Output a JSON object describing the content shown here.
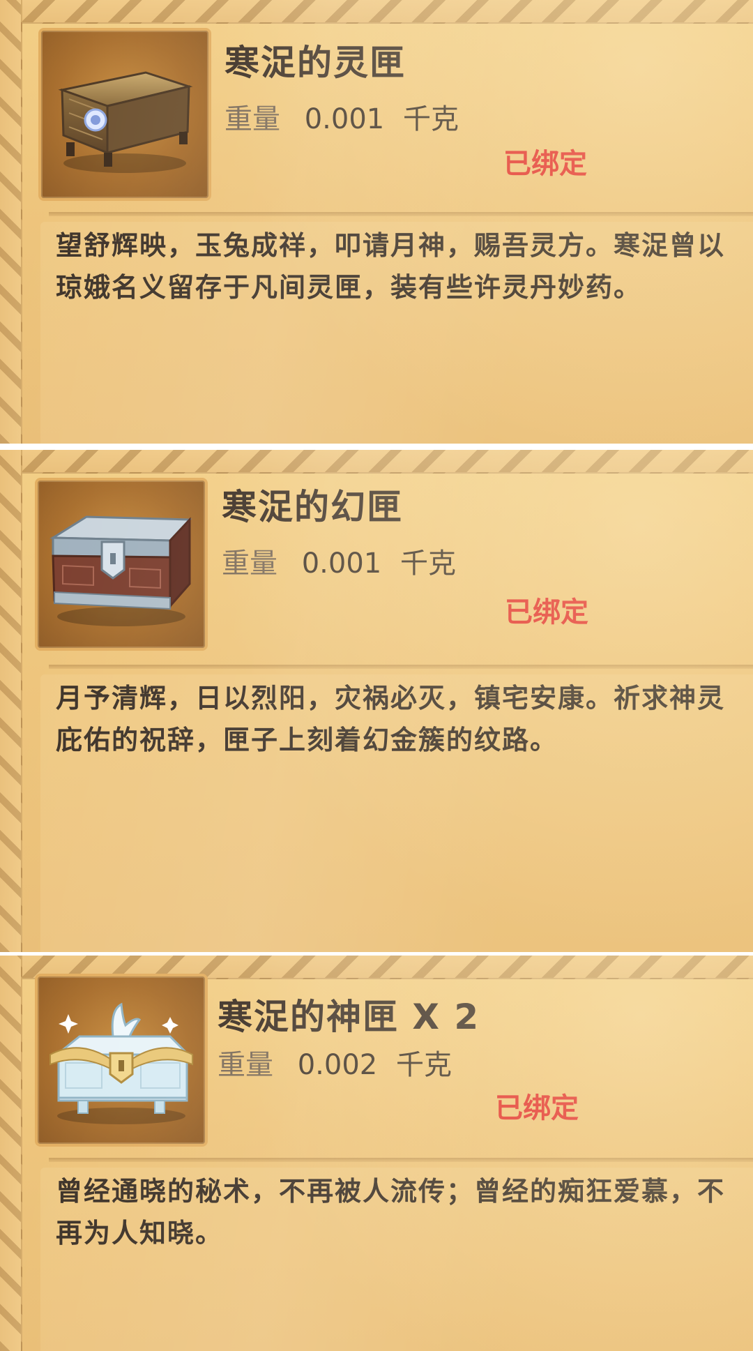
{
  "items": [
    {
      "name": "寒浞的灵匣",
      "weight_label": "重量",
      "weight_value": "0.001",
      "weight_unit": "千克",
      "status": "已绑定",
      "description": "望舒辉映，玉兔成祥，叩请月神，赐吾灵方。寒浞曾以琼娥名义留存于凡间灵匣，装有些许灵丹妙药。",
      "icon": "ornate-bronze-chest-icon"
    },
    {
      "name": "寒浞的幻匣",
      "weight_label": "重量",
      "weight_value": "0.001",
      "weight_unit": "千克",
      "status": "已绑定",
      "description": "月予清辉，日以烈阳，灾祸必灭，镇宅安康。祈求神灵庇佑的祝辞，匣子上刻着幻金簇的纹路。",
      "icon": "silver-red-chest-icon"
    },
    {
      "name": "寒浞的神匣 X 2",
      "weight_label": "重量",
      "weight_value": "0.002",
      "weight_unit": "千克",
      "status": "已绑定",
      "description": "曾经通晓的秘术，不再被人流传；曾经的痴狂爱慕，不再为人知晓。",
      "icon": "white-rabbit-chest-icon"
    }
  ],
  "colors": {
    "panel_bg": "#eec47a",
    "title": "#3c2f24",
    "bound": "#e2322a",
    "icon_bg": "#a86d2b"
  }
}
